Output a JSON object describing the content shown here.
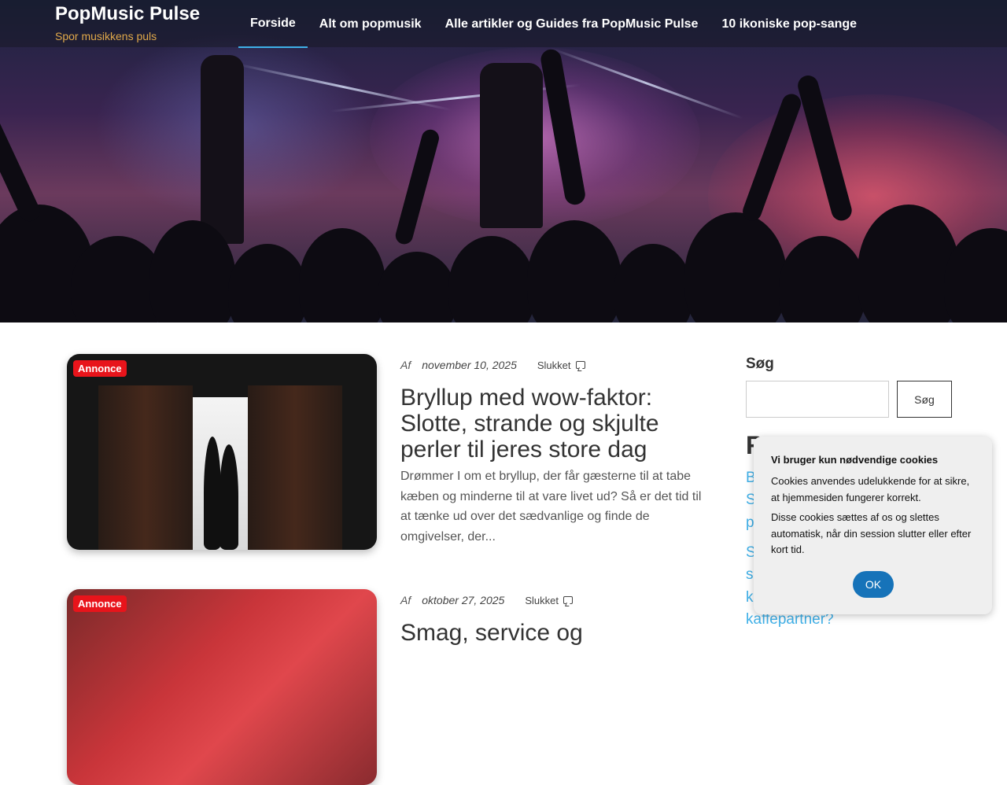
{
  "site": {
    "title": "PopMusic Pulse",
    "tagline": "Spor musikkens puls"
  },
  "nav": {
    "items": [
      {
        "label": "Forside",
        "active": true
      },
      {
        "label": "Alt om popmusik",
        "active": false
      },
      {
        "label": "Alle artikler og Guides fra PopMusic Pulse",
        "active": false
      },
      {
        "label": "10 ikoniske pop-sange",
        "active": false
      }
    ]
  },
  "posts": [
    {
      "badge": "Annonce",
      "by": "Af",
      "date": "november 10, 2025",
      "comments": "Slukket",
      "title": "Bryllup med wow-faktor: Slotte, strande og skjulte perler til jeres store dag",
      "excerpt": "Drømmer I om et bryllup, der får gæsterne til at tabe kæben og minderne til at vare livet ud? Så er det tid til at tænke ud over det sædvanlige og finde de omgivelser, der..."
    },
    {
      "badge": "Annonce",
      "by": "Af",
      "date": "oktober 27, 2025",
      "comments": "Slukket",
      "title": "Smag, service og"
    }
  ],
  "sidebar": {
    "search_title": "Søg",
    "search_button": "Søg",
    "search_value": "",
    "recent_heading": "R",
    "recent_links": [
      "B",
      "S",
      "p",
      "S",
      "s",
      "k",
      "kaffepartner?"
    ]
  },
  "cookie": {
    "title": "Vi bruger kun nødvendige cookies",
    "text1": "Cookies anvendes udelukkende for at sikre, at hjemmesiden fungerer korrekt.",
    "text2": "Disse cookies sættes af os og slettes automatisk, når din session slutter eller efter kort tid.",
    "ok": "OK"
  },
  "colors": {
    "accent": "#3fb0e8",
    "tagline": "#e0a84a",
    "badge": "#e8141b",
    "cookie_button": "#1673b9"
  }
}
